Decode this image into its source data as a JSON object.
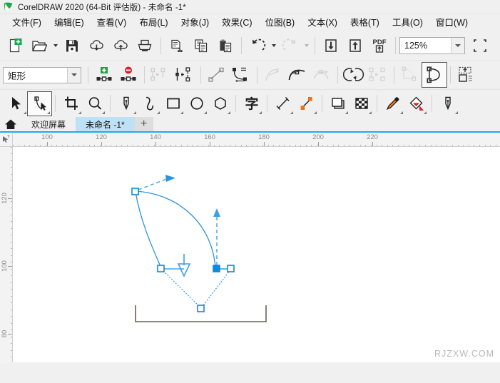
{
  "window": {
    "title": "CorelDRAW 2020 (64-Bit 评估版) - 未命名 -1*",
    "logo_icon": "coreldraw-balloon-icon"
  },
  "menubar": {
    "items": [
      {
        "label": "文件(F)",
        "name": "menu-file"
      },
      {
        "label": "编辑(E)",
        "name": "menu-edit"
      },
      {
        "label": "查看(V)",
        "name": "menu-view"
      },
      {
        "label": "布局(L)",
        "name": "menu-layout"
      },
      {
        "label": "对象(J)",
        "name": "menu-object"
      },
      {
        "label": "效果(C)",
        "name": "menu-effects"
      },
      {
        "label": "位图(B)",
        "name": "menu-bitmaps"
      },
      {
        "label": "文本(X)",
        "name": "menu-text"
      },
      {
        "label": "表格(T)",
        "name": "menu-table"
      },
      {
        "label": "工具(O)",
        "name": "menu-tools"
      },
      {
        "label": "窗口(W)",
        "name": "menu-window"
      }
    ]
  },
  "standard_toolbar": {
    "zoom_level": "125%",
    "pdf_label": "PDF",
    "buttons": [
      "new-document-icon",
      "open-document-icon",
      "save-icon",
      "cloud-download-icon",
      "cloud-upload-icon",
      "print-icon",
      "cut-icon",
      "copy-icon",
      "paste-icon",
      "undo-icon",
      "redo-icon",
      "import-icon",
      "export-icon",
      "publish-pdf-icon"
    ]
  },
  "property_bar": {
    "shape_type": "矩形",
    "buttons": [
      "add-node-icon",
      "delete-node-icon",
      "join-nodes-icon",
      "break-curve-icon",
      "convert-to-line-icon",
      "convert-to-curve-icon",
      "cusp-node-icon",
      "smooth-node-icon",
      "symmetrical-node-icon",
      "reverse-direction-icon",
      "extend-curve-icon",
      "close-curve-icon",
      "extract-subpath-icon",
      "auto-close-curve-icon"
    ]
  },
  "toolbox": {
    "active_tool": "shape-tool",
    "tools": [
      {
        "name": "pick-tool",
        "icon": "arrow-cursor-icon"
      },
      {
        "name": "shape-tool",
        "icon": "node-edit-icon"
      },
      {
        "name": "crop-tool",
        "icon": "crop-icon"
      },
      {
        "name": "zoom-tool",
        "icon": "magnifier-icon"
      },
      {
        "name": "freehand-tool",
        "icon": "pen-nib-icon"
      },
      {
        "name": "artistic-media-tool",
        "icon": "brush-stroke-icon"
      },
      {
        "name": "rectangle-tool",
        "icon": "rectangle-icon"
      },
      {
        "name": "ellipse-tool",
        "icon": "ellipse-icon"
      },
      {
        "name": "polygon-tool",
        "icon": "polygon-icon"
      },
      {
        "name": "text-tool",
        "icon": "text-zi-icon",
        "glyph": "字"
      },
      {
        "name": "dimension-tool",
        "icon": "dimension-line-icon"
      },
      {
        "name": "connector-tool",
        "icon": "connector-icon"
      },
      {
        "name": "drop-shadow-tool",
        "icon": "drop-shadow-icon"
      },
      {
        "name": "transparency-tool",
        "icon": "checkerboard-icon"
      },
      {
        "name": "color-eyedropper-tool",
        "icon": "eyedropper-icon"
      },
      {
        "name": "interactive-fill-tool",
        "icon": "fill-bucket-icon"
      },
      {
        "name": "outline-pen-tool",
        "icon": "outline-pen-icon"
      }
    ]
  },
  "tabbar": {
    "home_icon": "home-icon",
    "tabs": [
      {
        "label": "欢迎屏幕",
        "name": "tab-welcome-screen",
        "active": false
      },
      {
        "label": "未命名 -1*",
        "name": "tab-untitled-1",
        "active": true
      }
    ],
    "add_tab_label": "+"
  },
  "rulers": {
    "unit_icon": "ruler-unit-icon",
    "horizontal_labels": [
      "100",
      "120",
      "140",
      "160",
      "180",
      "200",
      "220"
    ],
    "horizontal_positions": [
      48,
      124,
      200,
      276,
      352,
      428,
      504
    ],
    "vertical_labels": [
      "120",
      "100",
      "80"
    ],
    "vertical_positions": [
      72,
      167,
      262
    ]
  },
  "canvas": {
    "colors": {
      "node_stroke": "#0d8bdb",
      "node_fill_selected": "#0d8bdb",
      "curve_stroke": "#2b93e0",
      "page_outline": "#6b6156",
      "handle_dashed": "#3aa0e8"
    },
    "objects": [
      {
        "name": "page-boundary-rect",
        "type": "rectangle"
      },
      {
        "name": "editable-curve-path",
        "type": "bezier-path"
      },
      {
        "name": "curve-node-top-left",
        "type": "node",
        "selected": false
      },
      {
        "name": "curve-node-left-mid",
        "type": "node",
        "selected": false
      },
      {
        "name": "curve-node-right-mid",
        "type": "node",
        "selected": true
      },
      {
        "name": "curve-node-bottom-apex",
        "type": "node",
        "selected": false
      },
      {
        "name": "control-handle-right-end",
        "type": "handle"
      },
      {
        "name": "control-handle-arrow-up",
        "type": "handle-arrow"
      },
      {
        "name": "control-handle-arrow-down",
        "type": "handle-arrow"
      },
      {
        "name": "control-handle-arrow-topright",
        "type": "handle-arrow"
      }
    ]
  },
  "watermark": {
    "text": "RJZXW.COM"
  }
}
